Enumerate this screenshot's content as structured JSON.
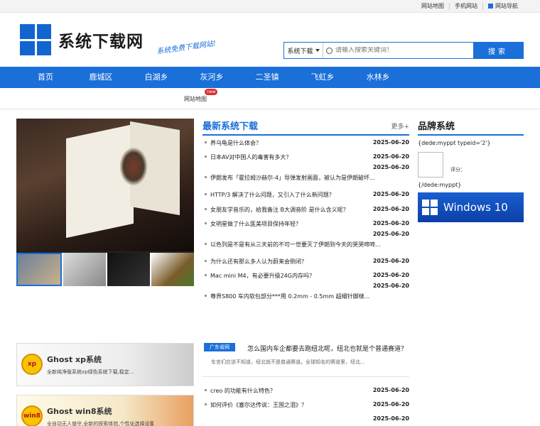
{
  "topbar": {
    "links": [
      "网站地图",
      "手机网站",
      "网站导航"
    ]
  },
  "header": {
    "site_name": "系统下载网",
    "slogan": "系统免费下载网站!",
    "search": {
      "category": "系统下载",
      "placeholder": "请输入搜索关键词！",
      "button": "搜索"
    }
  },
  "nav": {
    "items": [
      "首页",
      "鹿城区",
      "白湖乡",
      "灰河乡",
      "二圣镇",
      "飞虹乡",
      "水林乡"
    ]
  },
  "subnav": {
    "sitemap": "网站地图",
    "new_tag": "new"
  },
  "latest": {
    "title": "最新系统下载",
    "more": "更多+",
    "items": [
      {
        "text": "养乌龟是什么体会？",
        "date": "2025-06-20"
      },
      {
        "text": "日本AV对中国人的毒害有多大？",
        "date": "2025-06-20"
      },
      {
        "text": "伊朗发布「霍拉姆沙赫尔-4」导弹发射画面，被认为是伊朗破坏...",
        "date": "2025-06-20"
      },
      {
        "text": "HTTP/3 解决了什么问题，又引入了什么新问题？",
        "date": "2025-06-20"
      },
      {
        "text": "女朋友学音乐的，给我备注 B大调音阶 是什么含义呢？",
        "date": "2025-06-20"
      },
      {
        "text": "女明星做了什么医美项目保持年轻？",
        "date": "2025-06-20"
      },
      {
        "text": "以色列是不是有从三天前的不可一世要灭了伊朗到今天的哭哭啼啼...",
        "date": "2025-06-20"
      },
      {
        "text": "为什么还有那么多人认为蔚来会倒闭？",
        "date": "2025-06-20"
      },
      {
        "text": "Mac mini M4，有必要升级24G内存吗？",
        "date": "2025-06-20"
      },
      {
        "text": "尊界S800 车内软包部分***用 0.2mm - 0.5mm 超细针脚缝...",
        "date": "2025-06-20"
      }
    ]
  },
  "brand": {
    "title": "品牌系统",
    "tag_open": "{dede:myppt typeid='2'}",
    "rate_label": "评分：",
    "tag_close": "{/dede:myppt}",
    "win10_label": "Windows 10"
  },
  "panels": [
    {
      "badge": "xp",
      "title": "Ghost xp系统",
      "desc": "全新纯净版系统xp绿色系统下载,稳定..."
    },
    {
      "badge": "win8",
      "title": "Ghost win8系统",
      "desc": "全自动无人值守,全新的探索体验,个性化选择设置..."
    }
  ],
  "feature": {
    "tag": "广东省网",
    "title": "怎么国内车企都要去跑纽北呢，纽北也就是个普通赛道？",
    "desc": "车言们应该不知道，纽北就不是普通赛道。全球知名的赛道里，纽北..."
  },
  "list2": {
    "items": [
      {
        "text": "creo 的功能有什么特色？",
        "date": "2025-06-20"
      },
      {
        "text": "如何评价《塞尔达传说：王国之泪》？",
        "date": "2025-06-20"
      },
      {
        "text": "",
        "date": "2025-06-20"
      }
    ]
  },
  "colors": {
    "accent": "#1a6fd9",
    "nav_bg": "#1a6fd9"
  }
}
